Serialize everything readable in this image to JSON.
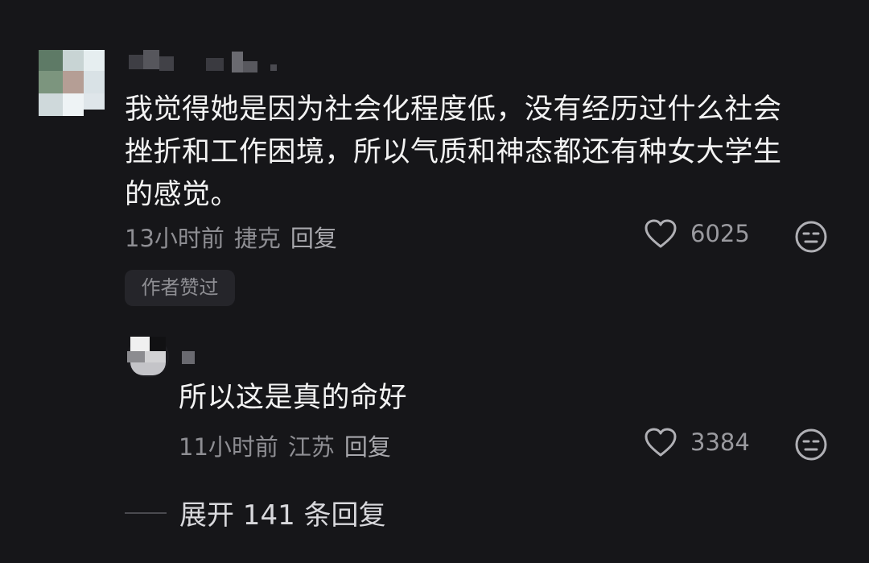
{
  "comment": {
    "text": "我觉得她是因为社会化程度低，没有经历过什么社会\n挫折和工作困境，所以气质和神态都还有种女大学生\n的感觉。",
    "time": "13小时前",
    "location": "捷克",
    "reply_label": "回复",
    "like_count": "6025",
    "author_badge": "作者赞过"
  },
  "reply": {
    "text": "所以这是真的命好",
    "time": "11小时前",
    "location": "江苏",
    "reply_label": "回复",
    "like_count": "3384"
  },
  "expand": {
    "label": "展开 141 条回复"
  },
  "icons": {
    "like": "heart-outline-icon",
    "dislike": "meh-face-icon"
  },
  "colors": {
    "background": "#161619",
    "primary_text": "#f3f3f3",
    "secondary_text": "#8e8e93"
  }
}
